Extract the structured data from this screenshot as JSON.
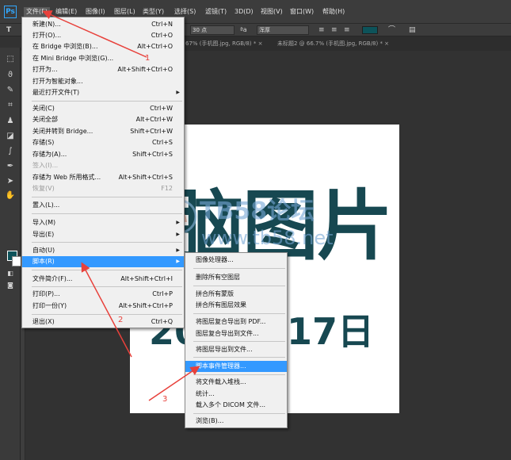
{
  "app": {
    "logo": "Ps"
  },
  "menubar": {
    "items": [
      "文件(F)",
      "编辑(E)",
      "图像(I)",
      "图层(L)",
      "类型(Y)",
      "选择(S)",
      "滤镜(T)",
      "3D(D)",
      "视图(V)",
      "窗口(W)",
      "帮助(H)"
    ]
  },
  "options_bar": {
    "type_tool_icon": "T",
    "font_size": "30 点",
    "aa_label": "ªa",
    "aa_mode": "浑厚",
    "align_icons": [
      "align-left-icon",
      "align-center-icon",
      "align-right-icon"
    ],
    "text_color": "#0d535a"
  },
  "tabs": [
    {
      "label": "67% (手机图.jpg, RGB/8) * ×"
    },
    {
      "label": "未标题2 @ 66.7% (手机图.jpg, RGB/8) * ×"
    }
  ],
  "canvas": {
    "headline": "脑图片",
    "date": "2015月17日",
    "text_color": "#174851",
    "watermark": {
      "name": "TB58论坛",
      "url": "www.tb58.net"
    }
  },
  "file_menu": {
    "items": [
      {
        "label": "新建(N)...",
        "shortcut": "Ctrl+N"
      },
      {
        "label": "打开(O)...",
        "shortcut": "Ctrl+O"
      },
      {
        "label": "在 Bridge 中浏览(B)...",
        "shortcut": "Alt+Ctrl+O"
      },
      {
        "label": "在 Mini Bridge 中浏览(G)...",
        "shortcut": ""
      },
      {
        "label": "打开为...",
        "shortcut": "Alt+Shift+Ctrl+O"
      },
      {
        "label": "打开为智能对象...",
        "shortcut": ""
      },
      {
        "label": "最近打开文件(T)",
        "shortcut": ""
      },
      {
        "label": "关闭(C)",
        "shortcut": "Ctrl+W"
      },
      {
        "label": "关闭全部",
        "shortcut": "Alt+Ctrl+W"
      },
      {
        "label": "关闭并转到 Bridge...",
        "shortcut": "Shift+Ctrl+W"
      },
      {
        "label": "存储(S)",
        "shortcut": "Ctrl+S"
      },
      {
        "label": "存储为(A)...",
        "shortcut": "Shift+Ctrl+S"
      },
      {
        "label": "签入(I)...",
        "shortcut": ""
      },
      {
        "label": "存储为 Web 所用格式...",
        "shortcut": "Alt+Shift+Ctrl+S"
      },
      {
        "label": "恢复(V)",
        "shortcut": "F12"
      },
      {
        "label": "置入(L)...",
        "shortcut": ""
      },
      {
        "label": "导入(M)",
        "shortcut": ""
      },
      {
        "label": "导出(E)",
        "shortcut": ""
      },
      {
        "label": "自动(U)",
        "shortcut": ""
      },
      {
        "label": "脚本(R)",
        "shortcut": ""
      },
      {
        "label": "文件简介(F)...",
        "shortcut": "Alt+Shift+Ctrl+I"
      },
      {
        "label": "打印(P)...",
        "shortcut": "Ctrl+P"
      },
      {
        "label": "打印一份(Y)",
        "shortcut": "Alt+Shift+Ctrl+P"
      },
      {
        "label": "退出(X)",
        "shortcut": "Ctrl+Q"
      }
    ]
  },
  "script_menu": {
    "items": [
      "图像处理器...",
      "删除所有空图层",
      "拼合所有蒙版",
      "拼合所有图层效果",
      "将图层复合导出到 PDF...",
      "图层复合导出到文件...",
      "将图层导出到文件...",
      "脚本事件管理器...",
      "将文件载入堆栈...",
      "统计...",
      "载入多个 DICOM 文件...",
      "浏览(B)..."
    ]
  },
  "annotations": {
    "labels": [
      "1",
      "2",
      "3"
    ],
    "color": "#e8413b"
  }
}
